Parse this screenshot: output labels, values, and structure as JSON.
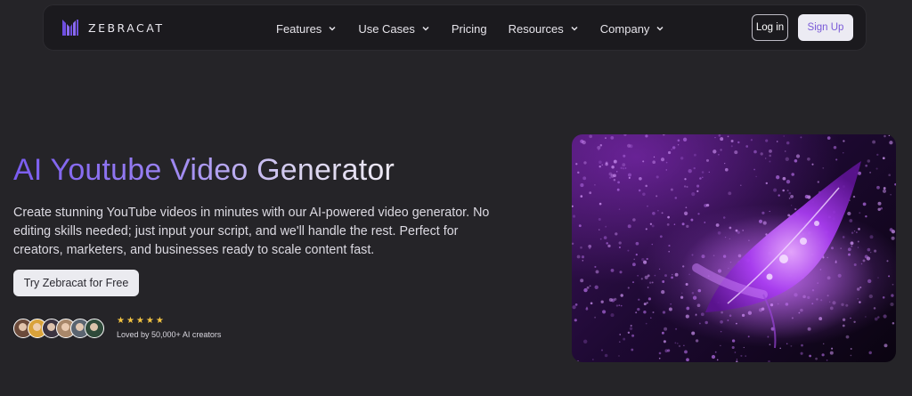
{
  "brand": {
    "name": "ZEBRACAT",
    "accent": "#7a5cf0"
  },
  "nav": {
    "items": [
      {
        "label": "Features",
        "dropdown": true
      },
      {
        "label": "Use Cases",
        "dropdown": true
      },
      {
        "label": "Pricing",
        "dropdown": false
      },
      {
        "label": "Resources",
        "dropdown": true
      },
      {
        "label": "Company",
        "dropdown": true
      }
    ],
    "login_label": "Log in",
    "signup_label": "Sign Up"
  },
  "hero": {
    "title": "AI Youtube Video Generator",
    "description": "Create stunning YouTube videos in minutes with our AI-powered video generator. No editing skills needed; just input your script, and we'll handle the rest. Perfect for creators, marketers, and businesses ready to scale content fast.",
    "cta_label": "Try Zebracat for Free",
    "rating_stars": "★★★★★",
    "rating": 5,
    "social_proof": "Loved by 50,000+ AI creators",
    "avatar_colors": [
      "#6b4a3a",
      "#d9a23a",
      "#3b3340",
      "#a8876a",
      "#5a6470",
      "#2f4a3a"
    ],
    "image_icon": "purple-feather-with-water-droplets-image"
  }
}
